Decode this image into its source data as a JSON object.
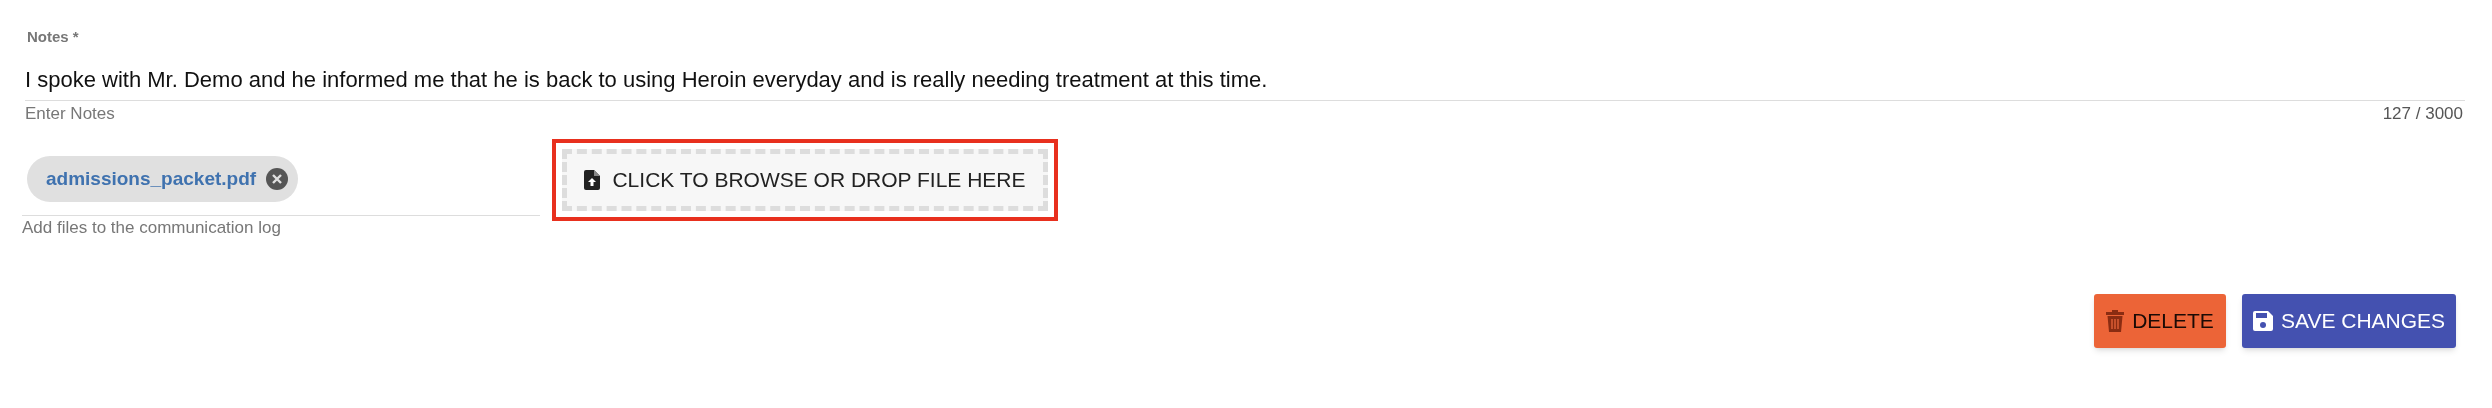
{
  "notes_field": {
    "label": "Notes *",
    "value": "I spoke with Mr. Demo and he informed me that he is back to using Heroin everyday and is really needing treatment at this time.",
    "helper": "Enter Notes",
    "counter": "127 / 3000"
  },
  "attachments": {
    "files": [
      {
        "name": "admissions_packet.pdf"
      }
    ],
    "helper": "Add files to the communication log",
    "dropzone": {
      "label": "CLICK TO BROWSE OR DROP FILE HERE",
      "highlighted": true
    }
  },
  "buttons": [
    {
      "kind": "delete",
      "label": "DELETE"
    },
    {
      "kind": "save",
      "label": "SAVE CHANGES"
    }
  ]
}
